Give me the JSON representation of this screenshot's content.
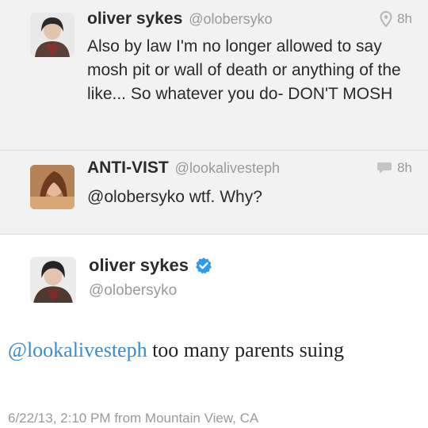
{
  "tweets": [
    {
      "name": "oliver sykes",
      "handle": "@olobersyko",
      "time": "8h",
      "meta_icon": "location-pin-icon",
      "text": "Also by law I'm no longer allowed to say mosh pit or wall of death or anything of the like... So whatever you do- DON'T MOSH"
    },
    {
      "name": "ANTI-VIST",
      "handle": "@lookalivesteph",
      "time": "8h",
      "meta_icon": "reply-bubble-icon",
      "text": "@olobersyko wtf. Why?"
    }
  ],
  "detail": {
    "name": "oliver sykes",
    "verified_icon": "verified-badge-icon",
    "handle": "@olobersyko",
    "mention": "@lookalivesteph",
    "text_rest": " too many parents suing",
    "timestamp": "6/22/13, 2:10 PM from Mountain View, CA"
  },
  "colors": {
    "mention": "#3b8bd0",
    "verified": "#2e9bf0",
    "muted": "#9a9a9a"
  }
}
